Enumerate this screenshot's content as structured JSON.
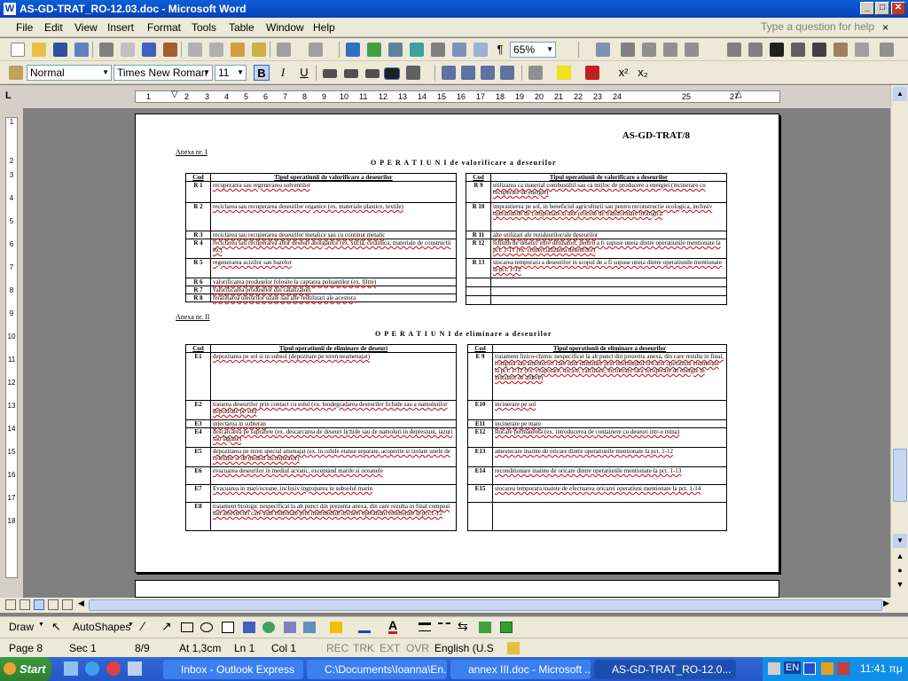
{
  "window": {
    "title": "AS-GD-TRAT_RO-12.03.doc - Microsoft Word",
    "minimize": "_",
    "maximize": "□",
    "close": "✕"
  },
  "menu": {
    "items": [
      "File",
      "Edit",
      "View",
      "Insert",
      "Format",
      "Tools",
      "Table",
      "Window",
      "Help"
    ],
    "ask_placeholder": "Type a question for help",
    "close": "×"
  },
  "toolbar": {
    "zoom": "65%",
    "paragraph": "¶"
  },
  "format": {
    "style": "Normal",
    "font": "Times New Roman",
    "size": "11",
    "bold": "B",
    "italic": "I",
    "underline": "U"
  },
  "ruler": {
    "marks": [
      "1",
      "2",
      "3",
      "4",
      "5",
      "6",
      "7",
      "8",
      "9",
      "10",
      "11",
      "12",
      "13",
      "14",
      "15",
      "16",
      "17",
      "18",
      "19",
      "20",
      "21",
      "22",
      "23",
      "24",
      "25",
      "27"
    ],
    "vmarks": [
      "1",
      "2",
      "3",
      "4",
      "5",
      "6",
      "7",
      "8",
      "9",
      "10",
      "11",
      "12",
      "13",
      "14",
      "15",
      "16",
      "17",
      "18"
    ]
  },
  "document": {
    "header": "AS-GD-TRAT/8",
    "anexa1": "Anexa nr. I",
    "title1": "O P E R A T I U N I   de valorificare a deseurilor",
    "col_code": "Cod",
    "col_type1": "Tipul operatiunii de valorificare a deseurilor",
    "r_left": [
      {
        "code": "R 1",
        "text": "recuperarea sau regenerarea solventilor"
      },
      {
        "code": "R 2",
        "text": "reciclarea sau recuperarea deseurilor organice (ex. materiale plastice, textile)"
      },
      {
        "code": "R 3",
        "text": "reciclarea sau recuperarea deseurilor metalice sau cu continut metalic"
      },
      {
        "code": "R 4",
        "text": "reciclarea sau recuperarea altor deseuri anorganice (ex. sticla, ceramica, materiale de constructii etc)"
      },
      {
        "code": "R 5",
        "text": "regenerarea acizilor sau bazelor"
      },
      {
        "code": "R 6",
        "text": "valorificarea produselor folosite la captarea poluantilor (ex. filtre)"
      },
      {
        "code": "R 7",
        "text": "valorificarea produselor din catalizatori"
      },
      {
        "code": "R 8",
        "text": "rerafinarea uleiurilor uzate sau alte reutilizari ale acestora"
      }
    ],
    "r_right": [
      {
        "code": "R 9",
        "text": "utilizarea ca material combustibil sau ca mijloc de producere a energiei (incinerare cu recuperare de energie)"
      },
      {
        "code": "R 10",
        "text": "imprastierea pe sol, in beneficiul agriculturii sau pentru reconstructie ecologica, inclusiv operatiunile de compostare si alte procese de transformare biologica"
      },
      {
        "code": "R 11",
        "text": "alte utilizari ale reziduurilor/ale deseurilor"
      },
      {
        "code": "R 12",
        "text": "schimb de deseuri intre detinatori, pentru a fi supuse uneia dintre operatiunile mentionate la pct. 1-11 (ex. comercializarea deseurilor)"
      },
      {
        "code": "R 13",
        "text": "stocarea temporara a deseurilor in scopul de a fi supuse uneia dintre operatiunile mentionate la pct. 1-12"
      }
    ],
    "anexa2": "Anexa nr. II",
    "title2": "O P E R A T I U N I   de eliminare a deseurilor",
    "col_type2": "Tipul operatiunii de eliminare de deseuri",
    "col_type2b": "Tipul operatiunii de eliminare a deseurilor",
    "e_left": [
      {
        "code": "E1",
        "text": "depozitarea pe sol si in subsol (depozitare pe teren neamenajat)"
      },
      {
        "code": "E2",
        "text": "tratarea deseurilor prin contact cu solul (ex. biodegradarea deseurilor lichide sau a namolurilor depozitate pe sol)"
      },
      {
        "code": "E3",
        "text": "injectarea in subteran"
      },
      {
        "code": "E4",
        "text": "descarcarea pe suprafete (ex. descarcarea de deseuri lichide sau de namoluri in depresiuni, iazuri sau lagune)"
      },
      {
        "code": "E5",
        "text": "depozitarea pe teren special amenajat (ex. in celule etanse separate, acoperite si izolate unele de celelalte si de mediul inconjurator)"
      },
      {
        "code": "E6",
        "text": "evacuarea deseurilor in mediul acvatic, exceptand marile si oceanele"
      },
      {
        "code": "E7",
        "text": "Evacuarea in mari/oceane, inclusiv ingroparea in subsolul marin"
      },
      {
        "code": "E8",
        "text": "tratament biologic nespecificat la alt punct din prezenta anexa, din care rezulta in final compusi sau amestecuri care sunt eliminate prin intermediul oricarei operatiuni enumerate la pct.1-12"
      }
    ],
    "e_right": [
      {
        "code": "E 9",
        "text": "tratament fizico-chimic nespecificat la alt punct din prezenta anexa, din care rezulta in final, compusi sau amestecuri care sunt eliminate prin intermediul oricarei operatiuni enumerate la pct. 1-12 (ex. evaporare, uscare, calcinare, incinerare fara recuperare de energie in instalatii de ardere)"
      },
      {
        "code": "E10",
        "text": "incinerare pe sol"
      },
      {
        "code": "E11",
        "text": "incinerare pe mare"
      },
      {
        "code": "E12",
        "text": "stocare permanenta (ex. introducerea de containere cu deseuri intr-o mina)"
      },
      {
        "code": "E13",
        "text": "amestecare inainte de oricare dintre operatiunile mentionate la pct. 1-12"
      },
      {
        "code": "E14",
        "text": "reconditionare inainte de oricare dintre operatiunile mentionate la pct. 1-13"
      },
      {
        "code": "E15",
        "text": "stocarea temporara inainte de efectuarea oricarei operatiuni mentionate la pct. 1-14"
      }
    ]
  },
  "drawbar": {
    "draw": "Draw",
    "autoshapes": "AutoShapes"
  },
  "status": {
    "page": "Page 8",
    "sec": "Sec 1",
    "pages": "8/9",
    "at": "At 1,3cm",
    "ln": "Ln 1",
    "col": "Col 1",
    "rec": "REC",
    "trk": "TRK",
    "ext": "EXT",
    "ovr": "OVR",
    "lang": "English (U.S"
  },
  "taskbar": {
    "start": "Start",
    "tasks": [
      "Inbox - Outlook Express",
      "C:\\Documents\\Ioanna\\En...",
      "annex III.doc - Microsoft ...",
      "AS-GD-TRAT_RO-12.0..."
    ],
    "lang": "EN",
    "clock": "11:41 πμ"
  },
  "colors": {
    "titlebar": "#0a5fd8",
    "taskbar": "#2457c8",
    "start": "#3c9a3c",
    "chrome": "#ece9d8"
  }
}
